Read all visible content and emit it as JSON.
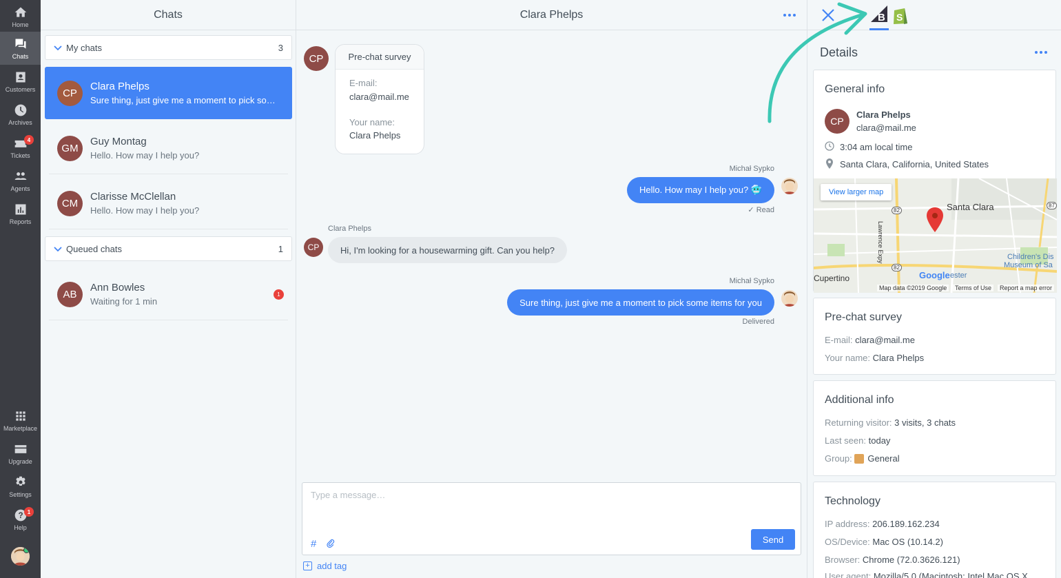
{
  "nav": {
    "home": "Home",
    "chats": "Chats",
    "customers": "Customers",
    "archives": "Archives",
    "tickets": "Tickets",
    "tickets_badge": "4",
    "agents": "Agents",
    "reports": "Reports",
    "marketplace": "Marketplace",
    "upgrade": "Upgrade",
    "settings": "Settings",
    "help": "Help",
    "help_badge": "1"
  },
  "chats_panel": {
    "title": "Chats",
    "my_chats": {
      "label": "My chats",
      "count": "3"
    },
    "items": [
      {
        "initials": "CP",
        "name": "Clara Phelps",
        "preview": "Sure thing, just give me a moment to pick som..."
      },
      {
        "initials": "GM",
        "name": "Guy Montag",
        "preview": "Hello. How may I help you?"
      },
      {
        "initials": "CM",
        "name": "Clarisse McClellan",
        "preview": "Hello. How may I help you?"
      }
    ],
    "queued": {
      "label": "Queued chats",
      "count": "1"
    },
    "queued_items": [
      {
        "initials": "AB",
        "name": "Ann Bowles",
        "preview": "Waiting for 1 min",
        "badge": "1"
      }
    ]
  },
  "conversation": {
    "title": "Clara Phelps",
    "customer_initials": "CP",
    "survey": {
      "title": "Pre-chat survey",
      "email_label": "E-mail:",
      "email": "clara@mail.me",
      "name_label": "Your name:",
      "name": "Clara Phelps"
    },
    "messages": [
      {
        "author": "Michał Sypko",
        "text": "Hello. How may I help you? 🥶",
        "status": "✓ Read"
      },
      {
        "author": "Clara Phelps",
        "text": "Hi, I'm looking for a housewarming gift. Can you help?"
      },
      {
        "author": "Michał Sypko",
        "text": "Sure thing, just give me a moment to pick some items for you",
        "status": "Delivered"
      }
    ],
    "composer": {
      "placeholder": "Type a message…",
      "send": "Send",
      "hash": "#",
      "add_tag": "add tag"
    }
  },
  "details": {
    "title": "Details",
    "general": {
      "title": "General info",
      "initials": "CP",
      "name": "Clara Phelps",
      "email": "clara@mail.me",
      "time": "3:04 am local time",
      "location": "Santa Clara, California, United States"
    },
    "map": {
      "view_larger": "View larger map",
      "city": "Santa Clara",
      "cupertino": "Cupertino",
      "childrens": "Children's Dis",
      "museum": "Museum of Sa",
      "lawrence": "Lawrence Expy",
      "route_82a": "82",
      "route_82b": "82",
      "route_87": "87",
      "google": "Google",
      "ester": "ester",
      "footer_data": "Map data ©2019 Google",
      "footer_terms": "Terms of Use",
      "footer_report": "Report a map error"
    },
    "prechat": {
      "title": "Pre-chat survey",
      "email_label": "E-mail:",
      "email": "clara@mail.me",
      "name_label": "Your name:",
      "name": "Clara Phelps"
    },
    "additional": {
      "title": "Additional info",
      "returning_label": "Returning visitor:",
      "returning": "3 visits, 3 chats",
      "last_seen_label": "Last seen:",
      "last_seen": "today",
      "group_label": "Group:",
      "group": "General"
    },
    "technology": {
      "title": "Technology",
      "ip_label": "IP address:",
      "ip": "206.189.162.234",
      "os_label": "OS/Device:",
      "os": "Mac OS (10.14.2)",
      "browser_label": "Browser:",
      "browser": "Chrome (72.0.3626.121)",
      "ua_label": "User agent:",
      "ua": "Mozilla/5.0 (Macintosh; Intel Mac OS X"
    }
  },
  "colors": {
    "accent": "#4384f5",
    "nav_bg": "#3b3d43",
    "arrow": "#3cc8b4",
    "badge": "#e9413b"
  }
}
